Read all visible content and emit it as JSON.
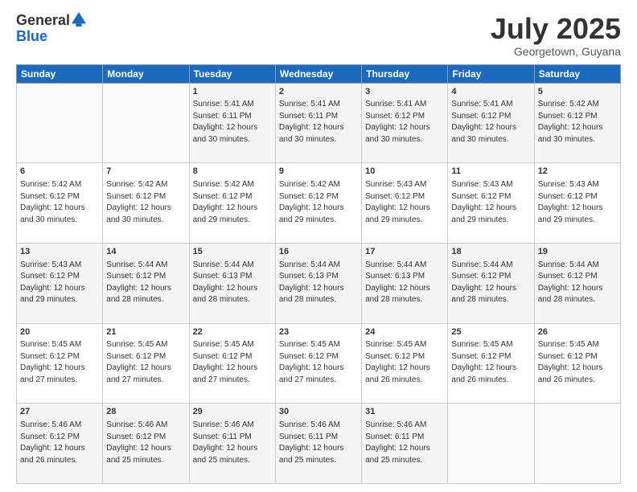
{
  "logo": {
    "general": "General",
    "blue": "Blue"
  },
  "title": {
    "month_year": "July 2025",
    "location": "Georgetown, Guyana"
  },
  "weekdays": [
    "Sunday",
    "Monday",
    "Tuesday",
    "Wednesday",
    "Thursday",
    "Friday",
    "Saturday"
  ],
  "weeks": [
    [
      {
        "day": "",
        "info": ""
      },
      {
        "day": "",
        "info": ""
      },
      {
        "day": "1",
        "info": "Sunrise: 5:41 AM\nSunset: 6:11 PM\nDaylight: 12 hours and 30 minutes."
      },
      {
        "day": "2",
        "info": "Sunrise: 5:41 AM\nSunset: 6:11 PM\nDaylight: 12 hours and 30 minutes."
      },
      {
        "day": "3",
        "info": "Sunrise: 5:41 AM\nSunset: 6:12 PM\nDaylight: 12 hours and 30 minutes."
      },
      {
        "day": "4",
        "info": "Sunrise: 5:41 AM\nSunset: 6:12 PM\nDaylight: 12 hours and 30 minutes."
      },
      {
        "day": "5",
        "info": "Sunrise: 5:42 AM\nSunset: 6:12 PM\nDaylight: 12 hours and 30 minutes."
      }
    ],
    [
      {
        "day": "6",
        "info": "Sunrise: 5:42 AM\nSunset: 6:12 PM\nDaylight: 12 hours and 30 minutes."
      },
      {
        "day": "7",
        "info": "Sunrise: 5:42 AM\nSunset: 6:12 PM\nDaylight: 12 hours and 30 minutes."
      },
      {
        "day": "8",
        "info": "Sunrise: 5:42 AM\nSunset: 6:12 PM\nDaylight: 12 hours and 29 minutes."
      },
      {
        "day": "9",
        "info": "Sunrise: 5:42 AM\nSunset: 6:12 PM\nDaylight: 12 hours and 29 minutes."
      },
      {
        "day": "10",
        "info": "Sunrise: 5:43 AM\nSunset: 6:12 PM\nDaylight: 12 hours and 29 minutes."
      },
      {
        "day": "11",
        "info": "Sunrise: 5:43 AM\nSunset: 6:12 PM\nDaylight: 12 hours and 29 minutes."
      },
      {
        "day": "12",
        "info": "Sunrise: 5:43 AM\nSunset: 6:12 PM\nDaylight: 12 hours and 29 minutes."
      }
    ],
    [
      {
        "day": "13",
        "info": "Sunrise: 5:43 AM\nSunset: 6:12 PM\nDaylight: 12 hours and 29 minutes."
      },
      {
        "day": "14",
        "info": "Sunrise: 5:44 AM\nSunset: 6:12 PM\nDaylight: 12 hours and 28 minutes."
      },
      {
        "day": "15",
        "info": "Sunrise: 5:44 AM\nSunset: 6:13 PM\nDaylight: 12 hours and 28 minutes."
      },
      {
        "day": "16",
        "info": "Sunrise: 5:44 AM\nSunset: 6:13 PM\nDaylight: 12 hours and 28 minutes."
      },
      {
        "day": "17",
        "info": "Sunrise: 5:44 AM\nSunset: 6:13 PM\nDaylight: 12 hours and 28 minutes."
      },
      {
        "day": "18",
        "info": "Sunrise: 5:44 AM\nSunset: 6:12 PM\nDaylight: 12 hours and 28 minutes."
      },
      {
        "day": "19",
        "info": "Sunrise: 5:44 AM\nSunset: 6:12 PM\nDaylight: 12 hours and 28 minutes."
      }
    ],
    [
      {
        "day": "20",
        "info": "Sunrise: 5:45 AM\nSunset: 6:12 PM\nDaylight: 12 hours and 27 minutes."
      },
      {
        "day": "21",
        "info": "Sunrise: 5:45 AM\nSunset: 6:12 PM\nDaylight: 12 hours and 27 minutes."
      },
      {
        "day": "22",
        "info": "Sunrise: 5:45 AM\nSunset: 6:12 PM\nDaylight: 12 hours and 27 minutes."
      },
      {
        "day": "23",
        "info": "Sunrise: 5:45 AM\nSunset: 6:12 PM\nDaylight: 12 hours and 27 minutes."
      },
      {
        "day": "24",
        "info": "Sunrise: 5:45 AM\nSunset: 6:12 PM\nDaylight: 12 hours and 26 minutes."
      },
      {
        "day": "25",
        "info": "Sunrise: 5:45 AM\nSunset: 6:12 PM\nDaylight: 12 hours and 26 minutes."
      },
      {
        "day": "26",
        "info": "Sunrise: 5:45 AM\nSunset: 6:12 PM\nDaylight: 12 hours and 26 minutes."
      }
    ],
    [
      {
        "day": "27",
        "info": "Sunrise: 5:46 AM\nSunset: 6:12 PM\nDaylight: 12 hours and 26 minutes."
      },
      {
        "day": "28",
        "info": "Sunrise: 5:46 AM\nSunset: 6:12 PM\nDaylight: 12 hours and 25 minutes."
      },
      {
        "day": "29",
        "info": "Sunrise: 5:46 AM\nSunset: 6:11 PM\nDaylight: 12 hours and 25 minutes."
      },
      {
        "day": "30",
        "info": "Sunrise: 5:46 AM\nSunset: 6:11 PM\nDaylight: 12 hours and 25 minutes."
      },
      {
        "day": "31",
        "info": "Sunrise: 5:46 AM\nSunset: 6:11 PM\nDaylight: 12 hours and 25 minutes."
      },
      {
        "day": "",
        "info": ""
      },
      {
        "day": "",
        "info": ""
      }
    ]
  ]
}
